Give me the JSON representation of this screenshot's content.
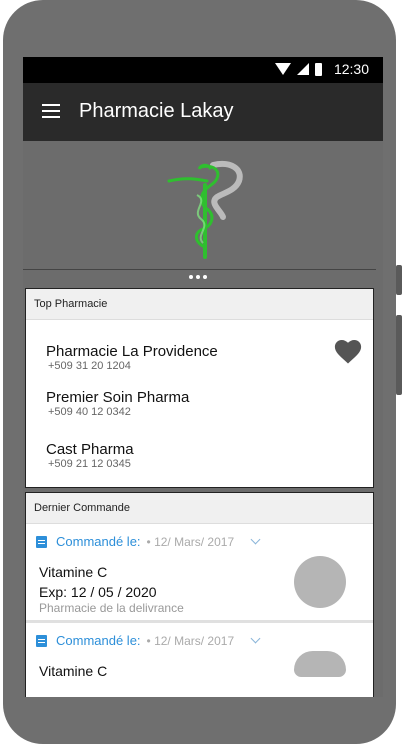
{
  "status_bar": {
    "time": "12:30",
    "icons": [
      "wifi-icon",
      "signal-icon",
      "battery-icon"
    ]
  },
  "app_bar": {
    "title": "Pharmacie Lakay",
    "menu_icon": "hamburger-menu-icon"
  },
  "hero": {
    "logo_icon": "caduceus-logo-icon"
  },
  "top_pharmacies": {
    "header": "Top Pharmacie",
    "items": [
      {
        "name": "Pharmacie La Providence",
        "phone": "+509 31 20 1204"
      },
      {
        "name": "Premier Soin Pharma",
        "phone": "+509 40 12 0342"
      },
      {
        "name": "Cast Pharma",
        "phone": "+509 21 12 0345"
      }
    ],
    "favorite_icon": "heart-icon"
  },
  "orders": {
    "header": "Dernier Commande",
    "items": [
      {
        "label": "Commandé le:",
        "date": "• 12/ Mars/ 2017",
        "product": "Vitamine C",
        "expiry": "Exp: 12 / 05 / 2020",
        "pharmacy": "Pharmacie de la delivrance"
      },
      {
        "label": "Commandé le:",
        "date": "• 12/ Mars/ 2017",
        "product": "Vitamine C"
      }
    ]
  },
  "colors": {
    "accent": "#2d8fd9",
    "app_bar": "#2a2a2a",
    "background": "#6c6c6c",
    "logo_green": "#2fbf2f"
  }
}
